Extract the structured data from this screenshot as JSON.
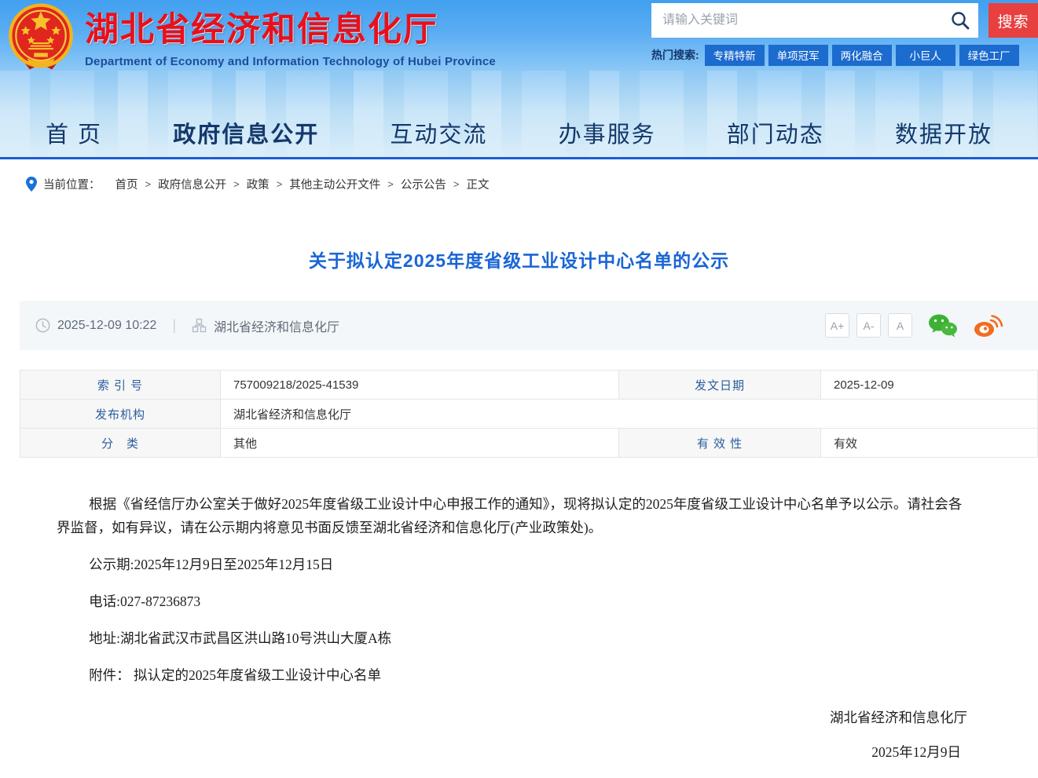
{
  "header": {
    "site_title": "湖北省经济和信息化厅",
    "site_subtitle": "Department of Economy and Information Technology of Hubei Province",
    "search": {
      "placeholder": "请输入关键词",
      "button": "搜索"
    },
    "hot_search": {
      "label": "热门搜索:",
      "tags": [
        "专精特新",
        "单项冠军",
        "两化融合",
        "小巨人",
        "绿色工厂"
      ]
    }
  },
  "nav": {
    "items": [
      {
        "label": "首 页"
      },
      {
        "label": "政府信息公开"
      },
      {
        "label": "互动交流"
      },
      {
        "label": "办事服务"
      },
      {
        "label": "部门动态"
      },
      {
        "label": "数据开放"
      }
    ]
  },
  "breadcrumb": {
    "label": "当前位置：",
    "separator": ">",
    "items": [
      "首页",
      "政府信息公开",
      "政策",
      "其他主动公开文件",
      "公示公告",
      "正文"
    ]
  },
  "article": {
    "title": "关于拟认定2025年度省级工业设计中心名单的公示",
    "meta": {
      "datetime": "2025-12-09 10:22",
      "source": "湖北省经济和信息化厅",
      "font_larger": "A+",
      "font_smaller": "A-",
      "font_reset": "A"
    },
    "info_table": {
      "row1": {
        "l1": "索 引 号",
        "v1": "757009218/2025-41539",
        "l2": "发文日期",
        "v2": "2025-12-09"
      },
      "row2": {
        "l1": "发布机构",
        "v1": "湖北省经济和信息化厅"
      },
      "row3": {
        "l1": "分　类",
        "v1": "其他",
        "l2": "有 效 性",
        "v2": "有效"
      }
    },
    "body": [
      "根据《省经信厅办公室关于做好2025年度省级工业设计中心申报工作的通知》，现将拟认定的2025年度省级工业设计中心名单予以公示。请社会各界监督，如有异议，请在公示期内将意见书面反馈至湖北省经济和信息化厅(产业政策处)。",
      "公示期:2025年12月9日至2025年12月15日",
      "电话:027-87236873",
      "地址:湖北省武汉市武昌区洪山路10号洪山大厦A栋",
      "附件： 拟认定的2025年度省级工业设计中心名单"
    ],
    "signature": {
      "org": "湖北省经济和信息化厅",
      "date": "2025年12月9日"
    }
  },
  "colors": {
    "accent_blue": "#1a65d5",
    "nav_text": "#14386b",
    "brand_red": "#e8101b",
    "search_button_red": "#e8403f",
    "hot_tag_blue": "#1c6bce",
    "table_label_blue": "#2a5e9e",
    "wechat_green": "#3eb135",
    "weibo_orange": "#f06d1f"
  }
}
